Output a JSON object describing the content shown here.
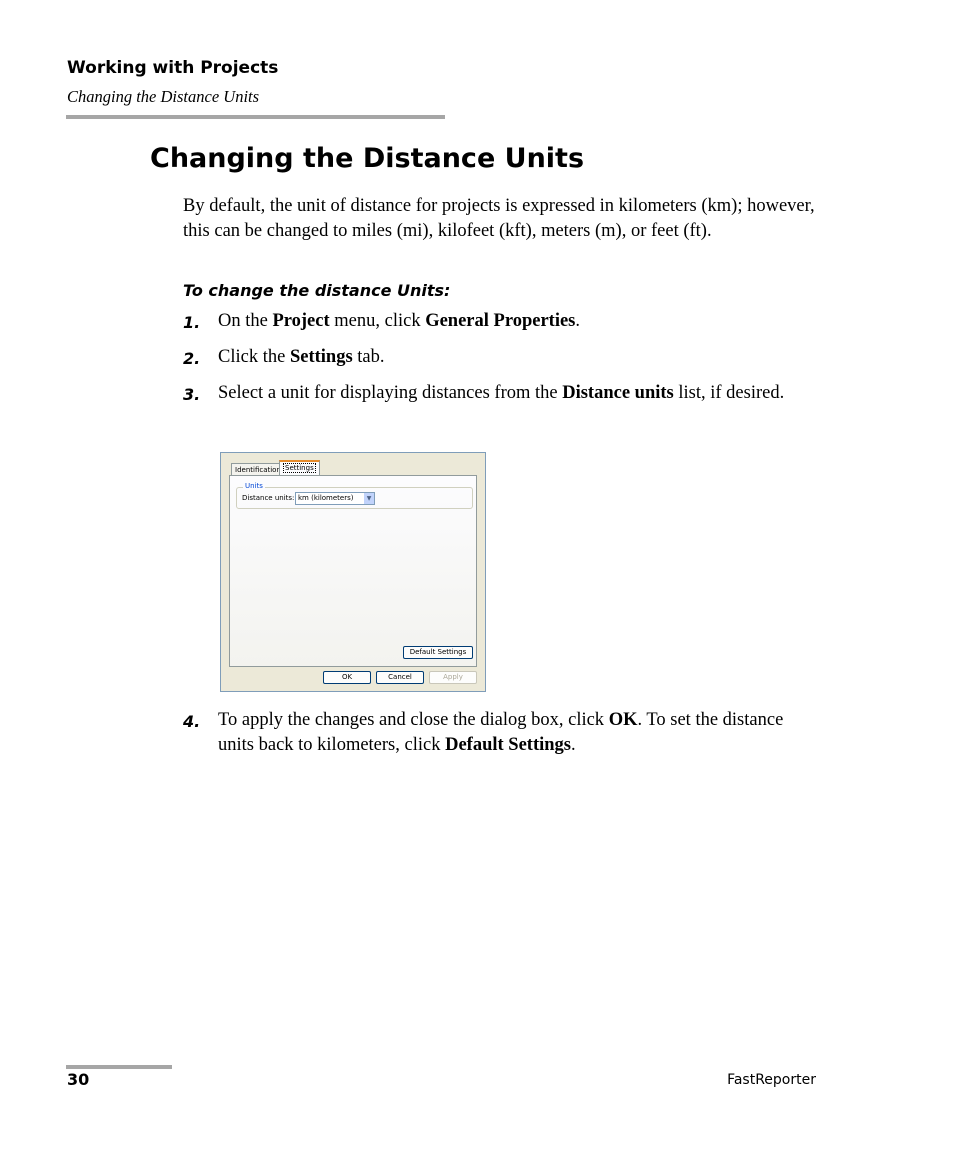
{
  "header": {
    "chapter": "Working with Projects",
    "section": "Changing the Distance Units"
  },
  "title": "Changing the Distance Units",
  "intro": "By default, the unit of distance for projects is expressed in kilometers (km); however, this can be changed to miles (mi), kilofeet (kft), meters (m), or feet (ft).",
  "procedure_title": "To change the distance Units:",
  "steps": [
    {
      "num": "1.",
      "a": "On the ",
      "b1": "Project",
      "c": " menu, click ",
      "b2": "General Properties",
      "d": "."
    },
    {
      "num": "2.",
      "a": "Click the ",
      "b1": "Settings",
      "c": " tab."
    },
    {
      "num": "3.",
      "a": "Select a unit for displaying distances from the ",
      "b1": "Distance units",
      "c": " list, if desired."
    },
    {
      "num": "4.",
      "a": "To apply the changes and close the dialog box, click ",
      "b1": "OK",
      "c": ". To set the distance units back to kilometers, click ",
      "b2": "Default Settings",
      "d": "."
    }
  ],
  "dialog": {
    "tabs": [
      "Identification",
      "Settings"
    ],
    "group_label": "Units",
    "distance_label": "Distance units:",
    "distance_value": "km (kilometers)",
    "default_button": "Default Settings",
    "ok_button": "OK",
    "cancel_button": "Cancel",
    "apply_button": "Apply"
  },
  "footer": {
    "page_number": "30",
    "product": "FastReporter"
  }
}
